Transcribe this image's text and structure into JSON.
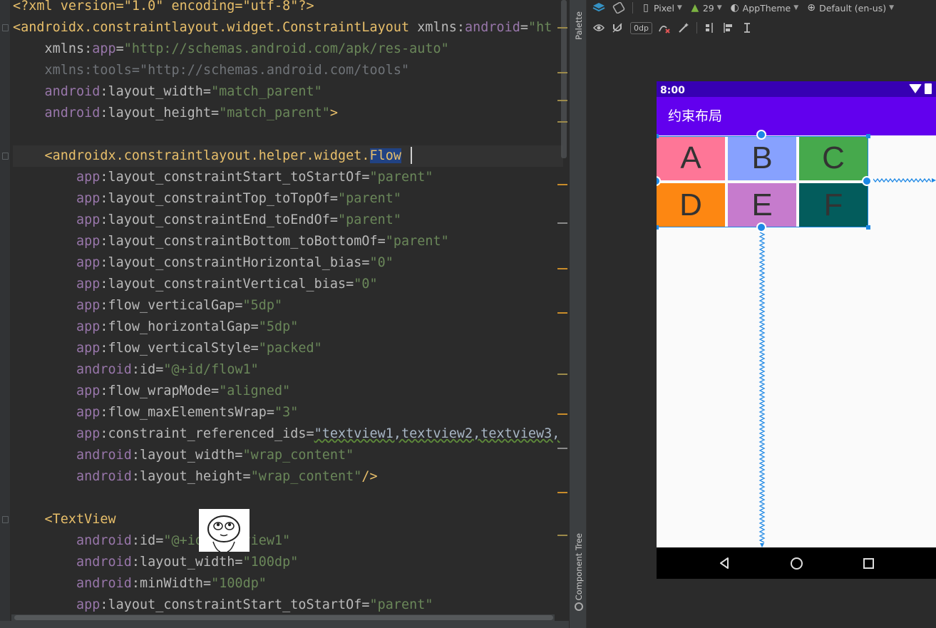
{
  "editor": {
    "lines": [
      [
        [
          "ap",
          "<?xml version=\"1.0\" encoding=\"utf-8\"?>"
        ]
      ],
      [
        [
          "tag",
          "<androidx.constraintlayout.widget.ConstraintLayout "
        ],
        [
          "at",
          "xmlns:"
        ],
        [
          "ns",
          "android"
        ],
        [
          "at",
          "="
        ],
        [
          "st",
          "\"ht"
        ]
      ],
      [
        [
          "at",
          "    xmlns:"
        ],
        [
          "ns",
          "app"
        ],
        [
          "at",
          "="
        ],
        [
          "st",
          "\"http://schemas.android.com/apk/res-auto\""
        ]
      ],
      [
        [
          "dim",
          "    xmlns:tools="
        ],
        [
          "dim",
          "\"http://schemas.android.com/tools\""
        ]
      ],
      [
        [
          "ns",
          "    android"
        ],
        [
          "at",
          ":layout_width="
        ],
        [
          "st",
          "\"match_parent\""
        ]
      ],
      [
        [
          "ns",
          "    android"
        ],
        [
          "at",
          ":layout_height="
        ],
        [
          "st",
          "\"match_parent\""
        ],
        [
          "tag",
          ">"
        ]
      ],
      [
        [
          "at",
          ""
        ]
      ],
      [
        [
          "tag",
          "    <androidx.constraintlayout.helper.widget."
        ],
        [
          "hl",
          "Flow"
        ]
      ],
      [
        [
          "ns",
          "        app"
        ],
        [
          "at",
          ":layout_constraintStart_toStartOf="
        ],
        [
          "st",
          "\"parent\""
        ]
      ],
      [
        [
          "ns",
          "        app"
        ],
        [
          "at",
          ":layout_constraintTop_toTopOf="
        ],
        [
          "st",
          "\"parent\""
        ]
      ],
      [
        [
          "ns",
          "        app"
        ],
        [
          "at",
          ":layout_constraintEnd_toEndOf="
        ],
        [
          "st",
          "\"parent\""
        ]
      ],
      [
        [
          "ns",
          "        app"
        ],
        [
          "at",
          ":layout_constraintBottom_toBottomOf="
        ],
        [
          "st",
          "\"parent\""
        ]
      ],
      [
        [
          "ns",
          "        app"
        ],
        [
          "at",
          ":layout_constraintHorizontal_bias="
        ],
        [
          "st",
          "\"0\""
        ]
      ],
      [
        [
          "ns",
          "        app"
        ],
        [
          "at",
          ":layout_constraintVertical_bias="
        ],
        [
          "st",
          "\"0\""
        ]
      ],
      [
        [
          "ns",
          "        app"
        ],
        [
          "at",
          ":flow_verticalGap="
        ],
        [
          "st",
          "\"5dp\""
        ]
      ],
      [
        [
          "ns",
          "        app"
        ],
        [
          "at",
          ":flow_horizontalGap="
        ],
        [
          "st",
          "\"5dp\""
        ]
      ],
      [
        [
          "ns",
          "        app"
        ],
        [
          "at",
          ":flow_verticalStyle="
        ],
        [
          "st",
          "\"packed\""
        ]
      ],
      [
        [
          "ns",
          "        android"
        ],
        [
          "at",
          ":id="
        ],
        [
          "st",
          "\"@+id/flow1\""
        ]
      ],
      [
        [
          "ns",
          "        app"
        ],
        [
          "at",
          ":flow_wrapMode="
        ],
        [
          "st",
          "\"aligned\""
        ]
      ],
      [
        [
          "ns",
          "        app"
        ],
        [
          "at",
          ":flow_maxElementsWrap="
        ],
        [
          "st",
          "\"3\""
        ]
      ],
      [
        [
          "ns",
          "        app"
        ],
        [
          "at",
          ":constraint_referenced_ids="
        ],
        [
          "wv",
          "\"textview1,textview2,textview3,"
        ]
      ],
      [
        [
          "ns",
          "        android"
        ],
        [
          "at",
          ":layout_width="
        ],
        [
          "st",
          "\"wrap_content\""
        ]
      ],
      [
        [
          "ns",
          "        android"
        ],
        [
          "at",
          ":layout_height="
        ],
        [
          "st",
          "\"wrap_content\""
        ],
        [
          "tag",
          "/>"
        ]
      ],
      [
        [
          "at",
          ""
        ]
      ],
      [
        [
          "tag",
          "    <TextView"
        ]
      ],
      [
        [
          "ns",
          "        android"
        ],
        [
          "at",
          ":id="
        ],
        [
          "st",
          "\"@+id/textview1\""
        ]
      ],
      [
        [
          "ns",
          "        android"
        ],
        [
          "at",
          ":layout_width="
        ],
        [
          "st",
          "\"100dp\""
        ]
      ],
      [
        [
          "ns",
          "        android"
        ],
        [
          "at",
          ":minWidth="
        ],
        [
          "st",
          "\"100dp\""
        ]
      ],
      [
        [
          "ns",
          "        app"
        ],
        [
          "at",
          ":layout_constraintStart_toStartOf="
        ],
        [
          "st",
          "\"parent\""
        ]
      ]
    ]
  },
  "side_tabs": {
    "palette": "Palette",
    "component_tree": "Component Tree"
  },
  "toolbar": {
    "device": "Pixel",
    "api": "29",
    "theme": "AppTheme",
    "locale": "Default (en-us)",
    "margin": "0dp"
  },
  "phone": {
    "time": "8:00",
    "app_title": "约束布局",
    "cells": [
      {
        "label": "A",
        "color": "#fe7697"
      },
      {
        "label": "B",
        "color": "#87a1fe"
      },
      {
        "label": "C",
        "color": "#46a94c"
      },
      {
        "label": "D",
        "color": "#fd8712"
      },
      {
        "label": "E",
        "color": "#c67bcd"
      },
      {
        "label": "F",
        "color": "#035c5c"
      }
    ]
  },
  "colors": {
    "accent": "#1e88e5",
    "status_bar": "#3700b3",
    "app_bar": "#6200ee"
  }
}
